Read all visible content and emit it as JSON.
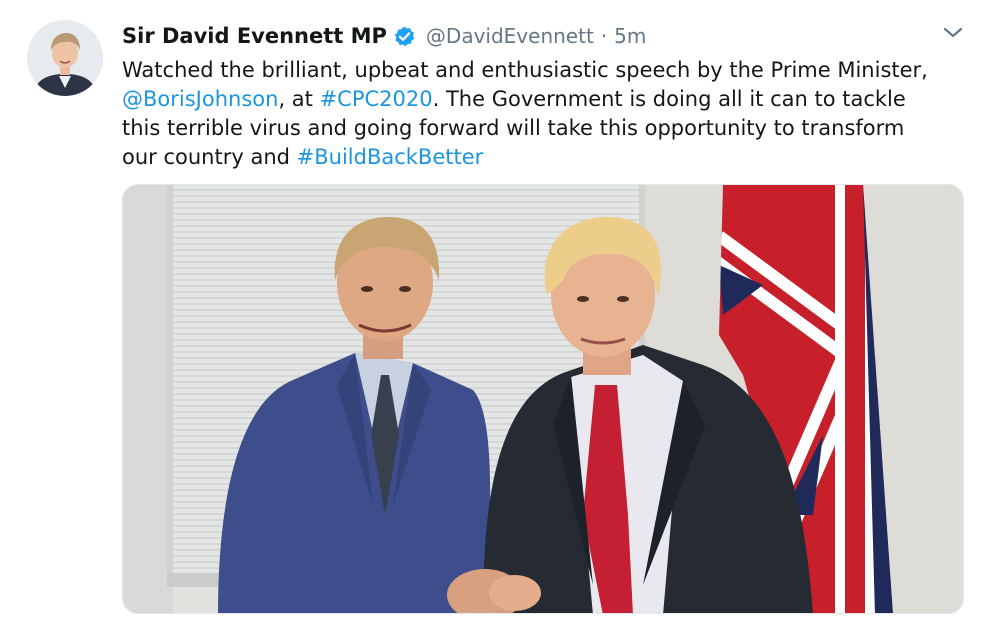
{
  "tweet": {
    "author": {
      "name": "Sir David Evennett MP",
      "handle": "@DavidEvennett",
      "verified": true,
      "avatar_icon": "profile-photo"
    },
    "separator": "·",
    "timestamp": "5m",
    "menu_icon": "chevron-down-icon",
    "text": {
      "l1": "Watched the brilliant, upbeat and enthusiastic speech by the Prime Minister,",
      "l2_mention": "@BorisJohnson",
      "l2_a": ", at ",
      "l2_hashtag": "#CPC2020",
      "l2_b": ". The Government is doing all it can to tackle",
      "l3": "this terrible virus and going forward will take this opportunity to transform",
      "l4_a": "our country and ",
      "l4_hashtag": "#BuildBackBetter"
    },
    "media": {
      "type": "photo"
    }
  },
  "colors": {
    "link": "#1b95e0",
    "verified": "#1da1f2",
    "secondary_text": "#657786",
    "primary_text": "#14171a"
  }
}
